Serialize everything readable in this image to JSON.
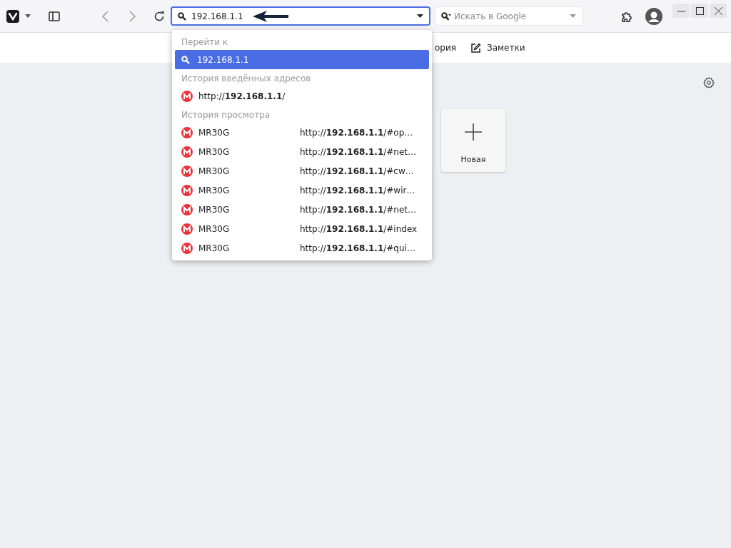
{
  "toolbar": {
    "address_field": {
      "value": "192.168.1.1"
    },
    "search_field": {
      "placeholder": "Искать в Google"
    }
  },
  "bookmarks": [
    {
      "kind": "plain",
      "label": "ория"
    },
    {
      "kind": "notes",
      "label": "Заметки"
    }
  ],
  "dropdown": {
    "sections": [
      {
        "heading": "Перейти к",
        "items": [
          {
            "kind": "search",
            "title": "192.168.1.1",
            "selected": true
          }
        ]
      },
      {
        "heading": "История введённых адресов",
        "items": [
          {
            "kind": "site",
            "title": "http://**192.168.1.1**/",
            "selected": false
          }
        ]
      },
      {
        "heading": "История просмотра",
        "items": [
          {
            "kind": "site",
            "title": "MR30G",
            "url": "http://**192.168.1.1**/#op…",
            "selected": false
          },
          {
            "kind": "site",
            "title": "MR30G",
            "url": "http://**192.168.1.1**/#net…",
            "selected": false
          },
          {
            "kind": "site",
            "title": "MR30G",
            "url": "http://**192.168.1.1**/#cw…",
            "selected": false
          },
          {
            "kind": "site",
            "title": "MR30G",
            "url": "http://**192.168.1.1**/#wir…",
            "selected": false
          },
          {
            "kind": "site",
            "title": "MR30G",
            "url": "http://**192.168.1.1**/#net…",
            "selected": false
          },
          {
            "kind": "site",
            "title": "MR30G",
            "url": "http://**192.168.1.1**/#index",
            "selected": false
          },
          {
            "kind": "site",
            "title": "MR30G",
            "url": "http://**192.168.1.1**/#qui…",
            "selected": false
          }
        ]
      }
    ]
  },
  "speed_dial": [
    {
      "kind": "add",
      "label": "Новая"
    }
  ]
}
